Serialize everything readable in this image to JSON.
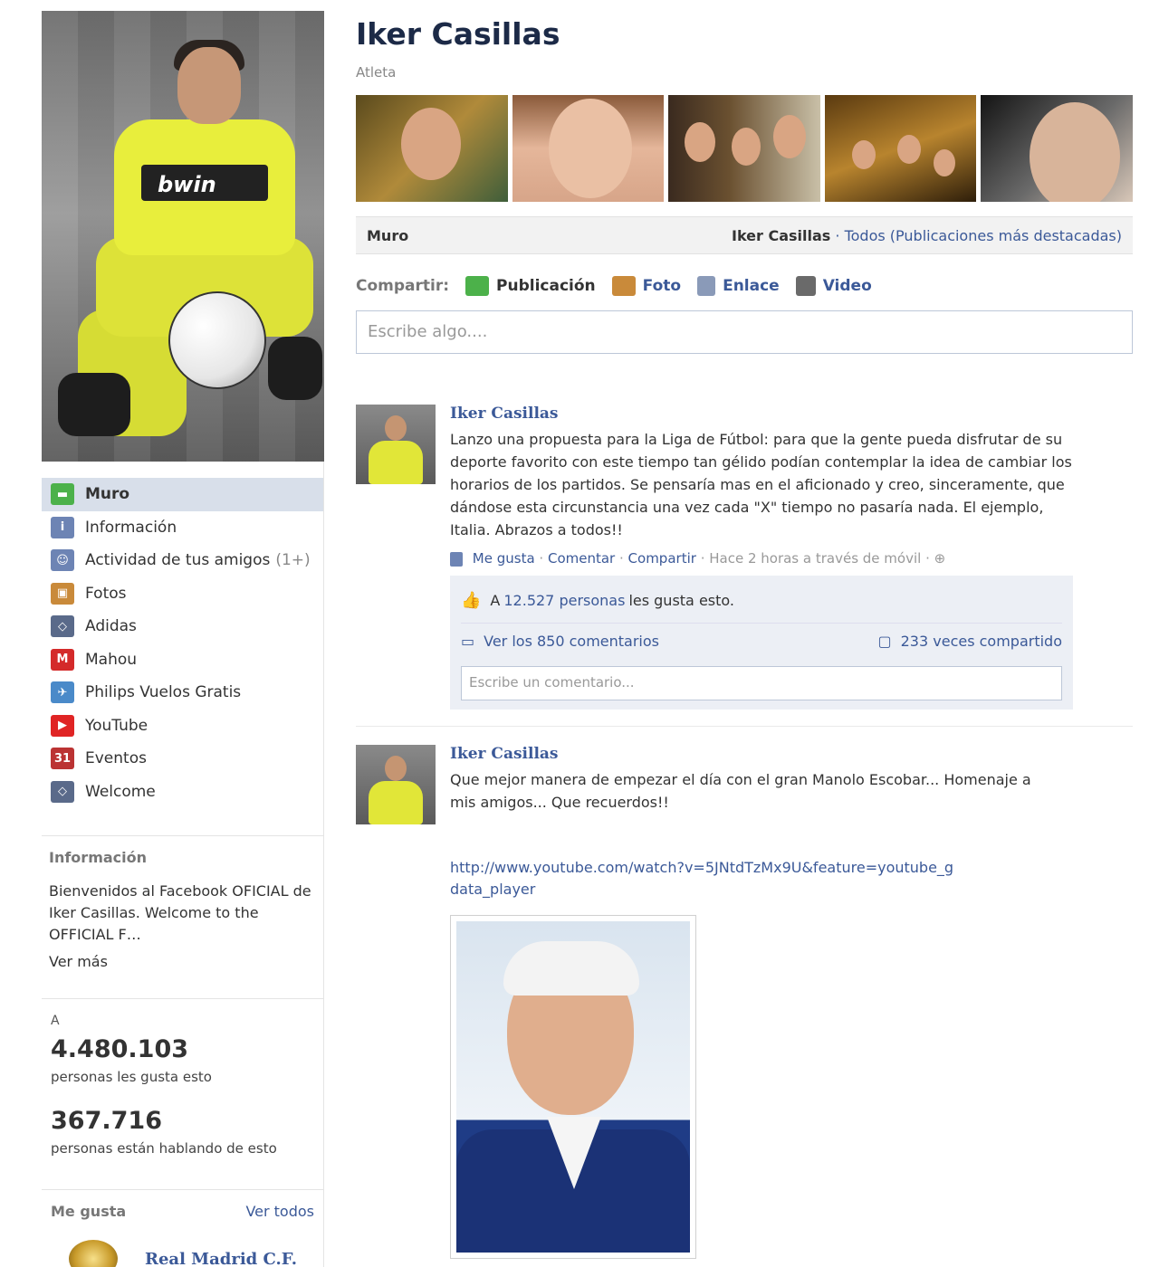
{
  "profile": {
    "name": "Iker Casillas",
    "category": "Atleta"
  },
  "nav": [
    {
      "label": "Muro",
      "icon": "wall-icon",
      "color": "#4cb14a"
    },
    {
      "label": "Información",
      "icon": "info-icon",
      "color": "#6d84b4"
    },
    {
      "label": "Actividad de tus amigos",
      "badge": "(1+)",
      "icon": "friends-icon",
      "color": "#6d84b4"
    },
    {
      "label": "Fotos",
      "icon": "photos-icon",
      "color": "#c98a3a"
    },
    {
      "label": "Adidas",
      "icon": "adidas-icon",
      "color": "#5a6a8a"
    },
    {
      "label": "Mahou",
      "icon": "mahou-icon",
      "color": "#d42a2a"
    },
    {
      "label": "Philips Vuelos Gratis",
      "icon": "philips-icon",
      "color": "#4a8ac9"
    },
    {
      "label": "YouTube",
      "icon": "youtube-icon",
      "color": "#e02424"
    },
    {
      "label": "Eventos",
      "icon": "calendar-icon",
      "color": "#b33"
    },
    {
      "label": "Welcome",
      "icon": "welcome-icon",
      "color": "#5a6a8a"
    }
  ],
  "info": {
    "title": "Información",
    "text": "Bienvenidos al Facebook OFICIAL de Iker Casillas. Welcome to the OFFICIAL F…",
    "more": "Ver más"
  },
  "stats": {
    "a": "A",
    "likes": "4.480.103",
    "likes_label": "personas les gusta esto",
    "talking": "367.716",
    "talking_label": "personas están hablando de esto"
  },
  "me_gusta": {
    "title": "Me gusta",
    "see_all": "Ver todos",
    "first": "Real Madrid C.F."
  },
  "wall_bar": {
    "left": "Muro",
    "name": "Iker Casillas",
    "filter": "· Todos (Publicaciones más destacadas)"
  },
  "share": {
    "label": "Compartir:",
    "options": [
      "Publicación",
      "Foto",
      "Enlace",
      "Video"
    ],
    "placeholder": "Escribe algo...."
  },
  "posts": [
    {
      "author": "Iker Casillas",
      "text": "Lanzo una propuesta para la Liga de Fútbol: para que la gente pueda disfrutar de su deporte favorito con este tiempo tan gélido podían contemplar la idea de cambiar los horarios de los partidos. Se pensaría mas en el aficionado y creo, sinceramente, que dándose esta circunstancia una vez cada \"X\" tiempo no pasaría nada. El ejemplo, Italia. Abrazos a todos!!",
      "like": "Me gusta",
      "comment": "Comentar",
      "share": "Compartir",
      "time": "Hace 2 horas a través de móvil",
      "likes_prefix": "A",
      "likes_count": "12.527 personas",
      "likes_suffix": "les gusta esto.",
      "comments_link": "Ver los 850 comentarios",
      "shared": "233 veces compartido",
      "comment_placeholder": "Escribe un comentario..."
    },
    {
      "author": "Iker Casillas",
      "text": "Que mejor manera de empezar el día con el gran Manolo Escobar... Homenaje a mis amigos... Que recuerdos!!",
      "link": "http://www.youtube.com/watch?v=5JNtdTzMx9U&feature=youtube_gdata_player"
    }
  ]
}
